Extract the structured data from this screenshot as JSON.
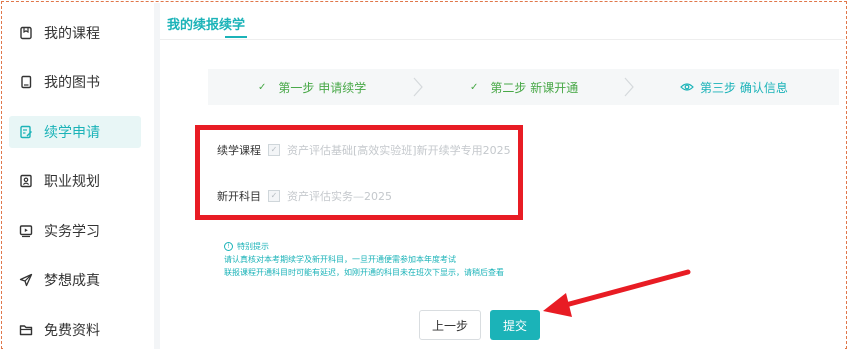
{
  "sidebar": {
    "items": [
      {
        "label": "我的课程",
        "icon": "bookmark-icon"
      },
      {
        "label": "我的图书",
        "icon": "book-icon"
      },
      {
        "label": "续学申请",
        "icon": "edit-document-icon",
        "active": true
      },
      {
        "label": "职业规划",
        "icon": "id-card-icon"
      },
      {
        "label": "实务学习",
        "icon": "video-icon"
      },
      {
        "label": "梦想成真",
        "icon": "paper-plane-icon"
      },
      {
        "label": "免费资料",
        "icon": "folder-icon"
      }
    ]
  },
  "page": {
    "title": "我的续报续学"
  },
  "steps": [
    {
      "label": "第一步 申请续学",
      "status": "done"
    },
    {
      "label": "第二步 新课开通",
      "status": "done"
    },
    {
      "label": "第三步 确认信息",
      "status": "current"
    }
  ],
  "form": {
    "course_label": "续学课程",
    "course_value": "资产评估基础[高效实验班]新开续学专用2025",
    "subject_label": "新开科目",
    "subject_value": "资产评估实务—2025"
  },
  "notice": {
    "title": "特别提示",
    "line1": "请认真核对本考期续学及新开科目，一旦开通便需参加本年度考试",
    "line2": "联报课程开通科目时可能有延迟，如刚开通的科目未在班次下显示，请稍后查看"
  },
  "buttons": {
    "prev": "上一步",
    "submit": "提交"
  },
  "colors": {
    "accent": "#1bb3b8",
    "done_green": "#48a847",
    "annotation_red": "#e81c24"
  }
}
